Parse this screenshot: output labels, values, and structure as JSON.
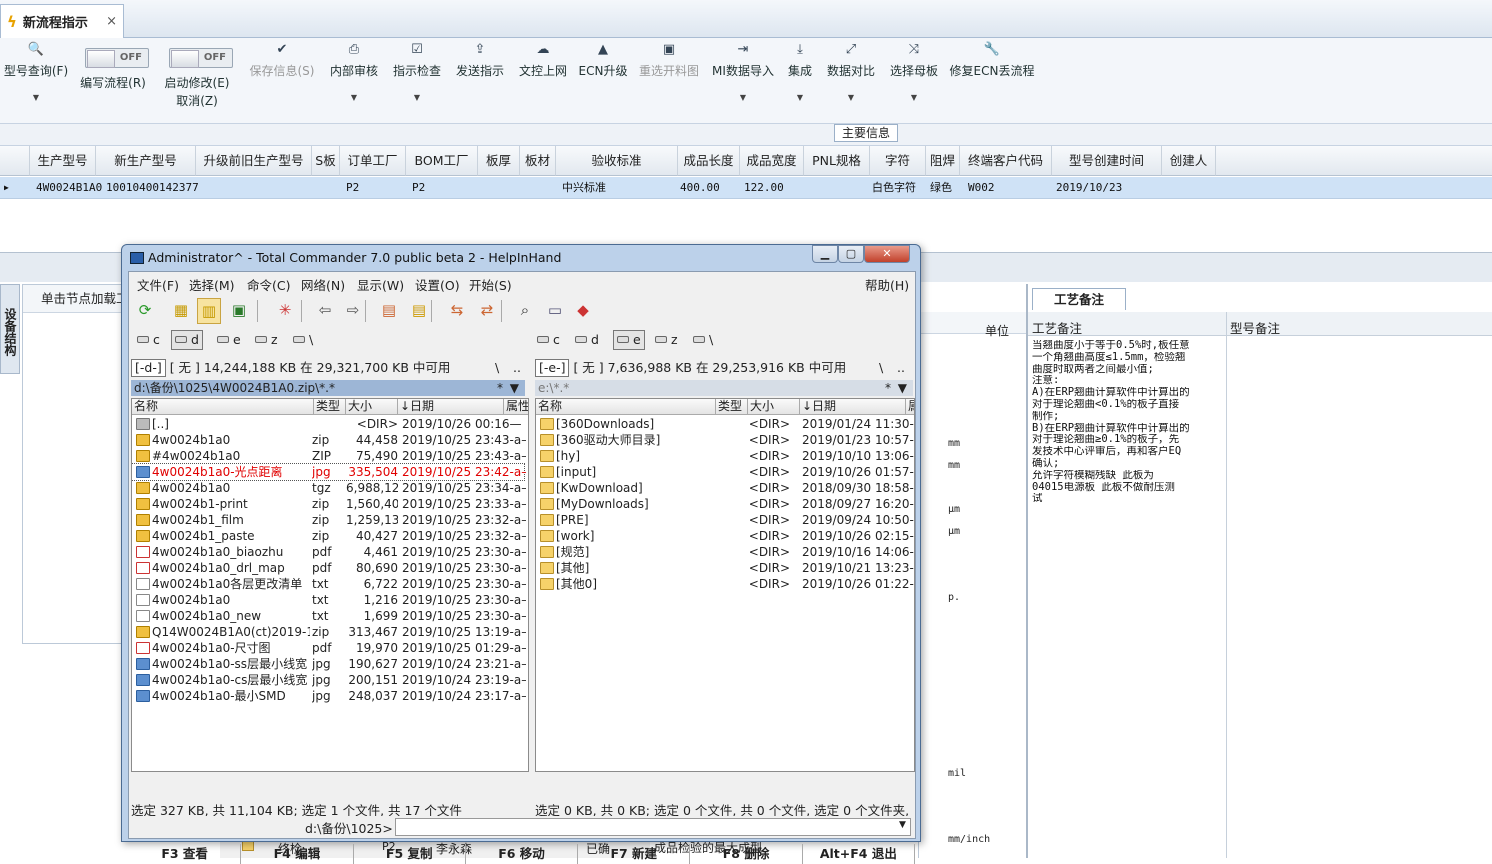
{
  "tab": {
    "title": "新流程指示",
    "close": "×",
    "icon": "lightning-icon"
  },
  "ribbon": {
    "items": [
      {
        "label": "型号查询(F)",
        "icon": "search-icon",
        "glyph": "🔍",
        "dropdown": true,
        "enabled": true
      },
      {
        "label": "编写流程(R)",
        "toggle": "OFF",
        "enabled": true
      },
      {
        "label": "启动修改(E)",
        "label2": "取消(Z)",
        "toggle": "OFF",
        "enabled": true
      },
      {
        "label": "保存信息(S)",
        "icon": "check-icon",
        "glyph": "✔",
        "enabled": false
      },
      {
        "label": "内部审核",
        "icon": "print-icon",
        "glyph": "⎙",
        "dropdown": true,
        "enabled": true
      },
      {
        "label": "指示检查",
        "icon": "checkbox-icon",
        "glyph": "☑",
        "dropdown": true,
        "enabled": true
      },
      {
        "label": "发送指示",
        "icon": "upload-icon",
        "glyph": "⇪",
        "enabled": true
      },
      {
        "label": "文控上网",
        "icon": "cloud-upload-icon",
        "glyph": "☁",
        "enabled": true
      },
      {
        "label": "ECN升级",
        "icon": "ecn-icon",
        "glyph": "▲",
        "enabled": true
      },
      {
        "label": "重选开料图",
        "icon": "image-icon",
        "glyph": "▣",
        "enabled": false
      },
      {
        "label": "MI数据导入",
        "icon": "import-icon",
        "glyph": "⇥",
        "dropdown": true,
        "enabled": true
      },
      {
        "label": "集成",
        "icon": "download-icon",
        "glyph": "⤓",
        "dropdown": true,
        "enabled": true
      },
      {
        "label": "数据对比",
        "icon": "compare-icon",
        "glyph": "⤢",
        "dropdown": true,
        "enabled": true
      },
      {
        "label": "选择母板",
        "icon": "shuffle-icon",
        "glyph": "⤨",
        "dropdown": true,
        "enabled": true
      },
      {
        "label": "修复ECN丢流程",
        "icon": "wrench-icon",
        "glyph": "🔧",
        "enabled": true
      }
    ]
  },
  "section_title": "主要信息",
  "grid": {
    "headers": [
      "生产型号",
      "新生产型号",
      "升级前旧生产型号",
      "S板",
      "订单工厂",
      "BOM工厂",
      "板厚",
      "板材",
      "验收标准",
      "成品长度",
      "成品宽度",
      "PNL规格",
      "字符",
      "阻焊",
      "终端客户代码",
      "型号创建时间",
      "创建人"
    ],
    "row": [
      "4W0024B1A0",
      "10010400142377",
      "",
      "",
      "P2",
      "P2",
      "",
      "",
      "中兴标准",
      "400.00",
      "122.00",
      "",
      "白色字符",
      "绿色",
      "W002",
      "2019/10/23",
      ""
    ]
  },
  "left_panel": {
    "vertical_tab": "设备结构",
    "header": "单击节点加载工"
  },
  "right_back": {
    "unit_header": "单位",
    "units": [
      "mm",
      "mm",
      "μm",
      "μm",
      "p.",
      "mil",
      "mm/inch"
    ]
  },
  "craft": {
    "tab": "工艺备注",
    "col1": "工艺备注",
    "col2": "型号备注",
    "lines": [
      "当翘曲度小于等于0.5%时,板任意",
      "一个角翘曲高度≤1.5mm，检验翘",
      "曲度时取两者之间最小值;",
      "注意:",
      "A)在ERP翘曲计算软件中计算出的",
      "对于理论翘曲<0.1%的板子直接",
      "制作;",
      "B)在ERP翘曲计算软件中计算出的",
      "对于理论翘曲≥0.1%的板子，先",
      "发技术中心评审后，再和客户EQ",
      "确认;",
      "允许字符模糊残缺    此板为",
      "04015电源板    此板不做耐压测",
      "试"
    ]
  },
  "bottom_strip": {
    "label1": "终检",
    "label2": "P2",
    "label3": "李永森",
    "label4": "已确",
    "label5": "成品检验的最大成型"
  },
  "tc": {
    "title": "Administrator^ - Total Commander 7.0 public beta 2 - HelpInHand",
    "menu": [
      "文件(F)",
      "选择(M)",
      "命令(C)",
      "网络(N)",
      "显示(W)",
      "设置(O)",
      "开始(S)",
      "帮助(H)"
    ],
    "drives": [
      "c",
      "d",
      "e",
      "z",
      "\\"
    ],
    "left": {
      "drive": "[-d-]",
      "info": "[ 无 ]  14,244,188 KB 在 29,321,700 KB 中可用",
      "path": "d:\\备份\\1025\\4W0024B1A0.zip\\*.*",
      "headers": [
        "名称",
        "类型",
        "大小",
        "↓日期",
        "属性"
      ],
      "files": [
        {
          "name": "[..]",
          "type": "",
          "size": "<DIR>",
          "date": "2019/10/26 00:16—",
          "icon": "up"
        },
        {
          "name": "4w0024b1a0",
          "type": "zip",
          "size": "44,458",
          "date": "2019/10/25 23:43-a–",
          "icon": "zip"
        },
        {
          "name": "#4w0024b1a0",
          "type": "ZIP",
          "size": "75,490",
          "date": "2019/10/25 23:43-a–",
          "icon": "zip"
        },
        {
          "name": "4w0024b1a0-光点距离",
          "type": "jpg",
          "size": "335,504",
          "date": "2019/10/25 23:42-a–",
          "icon": "img",
          "marked": true
        },
        {
          "name": "4w0024b1a0",
          "type": "tgz",
          "size": "6,988,121",
          "date": "2019/10/25 23:34-a–",
          "icon": "zip"
        },
        {
          "name": "4w0024b1-print",
          "type": "zip",
          "size": "1,560,402",
          "date": "2019/10/25 23:33-a–",
          "icon": "zip"
        },
        {
          "name": "4w0024b1_film",
          "type": "zip",
          "size": "1,259,137",
          "date": "2019/10/25 23:32-a–",
          "icon": "zip"
        },
        {
          "name": "4w0024b1_paste",
          "type": "zip",
          "size": "40,427",
          "date": "2019/10/25 23:32-a–",
          "icon": "zip"
        },
        {
          "name": "4w0024b1a0_biaozhu",
          "type": "pdf",
          "size": "4,461",
          "date": "2019/10/25 23:30-a–",
          "icon": "pdf"
        },
        {
          "name": "4w0024b1a0_drl_map",
          "type": "pdf",
          "size": "80,690",
          "date": "2019/10/25 23:30-a–",
          "icon": "pdf"
        },
        {
          "name": "4w0024b1a0各层更改清单",
          "type": "txt",
          "size": "6,722",
          "date": "2019/10/25 23:30-a–",
          "icon": "txt"
        },
        {
          "name": "4w0024b1a0",
          "type": "txt",
          "size": "1,216",
          "date": "2019/10/25 23:30-a–",
          "icon": "txt"
        },
        {
          "name": "4w0024b1a0_new",
          "type": "txt",
          "size": "1,699",
          "date": "2019/10/25 23:30-a–",
          "icon": "txt"
        },
        {
          "name": "Q14W0024B1A0(ct)2019-1...",
          "type": "zip",
          "size": "313,467",
          "date": "2019/10/25 13:19-a–",
          "icon": "zip"
        },
        {
          "name": "4w0024b1a0-尺寸图",
          "type": "pdf",
          "size": "19,970",
          "date": "2019/10/25 01:29-a–",
          "icon": "pdf"
        },
        {
          "name": "4w0024b1a0-ss层最小线宽",
          "type": "jpg",
          "size": "190,627",
          "date": "2019/10/24 23:21-a–",
          "icon": "img"
        },
        {
          "name": "4w0024b1a0-cs层最小线宽",
          "type": "jpg",
          "size": "200,151",
          "date": "2019/10/24 23:19-a–",
          "icon": "img"
        },
        {
          "name": "4w0024b1a0-最小SMD",
          "type": "jpg",
          "size": "248,037",
          "date": "2019/10/24 23:17-a–",
          "icon": "img"
        }
      ],
      "status": "选定 327 KB, 共 11,104 KB; 选定 1 个文件, 共 17 个文件"
    },
    "right": {
      "drive": "[-e-]",
      "info": "[ 无 ]  7,636,988 KB 在 29,253,916 KB 中可用",
      "path": "e:\\*.*",
      "headers": [
        "名称",
        "类型",
        "大小",
        "↓日期",
        "属"
      ],
      "files": [
        {
          "name": "[360Downloads]",
          "size": "<DIR>",
          "date": "2019/01/24 11:30-"
        },
        {
          "name": "[360驱动大师目录]",
          "size": "<DIR>",
          "date": "2019/01/23 10:57-"
        },
        {
          "name": "[hy]",
          "size": "<DIR>",
          "date": "2019/10/10 13:06-"
        },
        {
          "name": "[input]",
          "size": "<DIR>",
          "date": "2019/10/26 01:57-"
        },
        {
          "name": "[KwDownload]",
          "size": "<DIR>",
          "date": "2018/09/30 18:58-"
        },
        {
          "name": "[MyDownloads]",
          "size": "<DIR>",
          "date": "2018/09/27 16:20-"
        },
        {
          "name": "[PRE]",
          "size": "<DIR>",
          "date": "2019/09/24 10:50-"
        },
        {
          "name": "[work]",
          "size": "<DIR>",
          "date": "2019/10/26 02:15-"
        },
        {
          "name": "[规范]",
          "size": "<DIR>",
          "date": "2019/10/16 14:06-"
        },
        {
          "name": "[其他]",
          "size": "<DIR>",
          "date": "2019/10/21 13:23-"
        },
        {
          "name": "[其他0]",
          "size": "<DIR>",
          "date": "2019/10/26 01:22-"
        }
      ],
      "status": "选定 0 KB, 共 0 KB; 选定 0 个文件, 共 0 个文件, 选定 0 个文件夹,"
    },
    "cmd_prompt": "d:\\备份\\1025>",
    "fkeys": [
      "F3 查看",
      "F4 编辑",
      "F5 复制",
      "F6 移动",
      "F7 新建",
      "F8 删除",
      "Alt+F4 退出"
    ]
  }
}
